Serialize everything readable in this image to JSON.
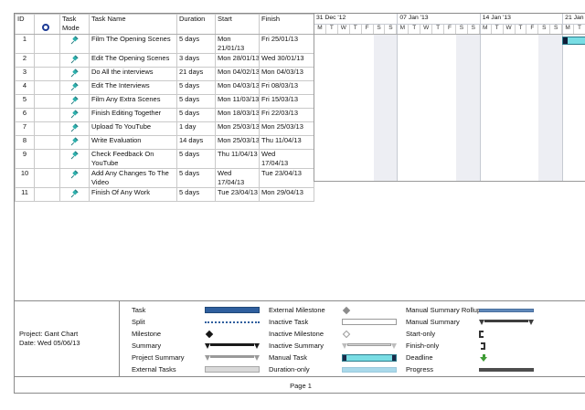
{
  "project_info": {
    "line1": "Project: Gant Chart",
    "line2": "Date: Wed 05/06/13"
  },
  "footer": {
    "page_label": "Page 1"
  },
  "table": {
    "columns": [
      {
        "key": "id",
        "label": "ID"
      },
      {
        "key": "info",
        "label": "",
        "icon": "info-indicator-icon"
      },
      {
        "key": "mode",
        "label": "Task\nMode"
      },
      {
        "key": "name",
        "label": "Task Name"
      },
      {
        "key": "duration",
        "label": "Duration"
      },
      {
        "key": "start",
        "label": "Start"
      },
      {
        "key": "finish",
        "label": "Finish"
      }
    ],
    "rows": [
      {
        "id": "1",
        "mode": "manual-pushpin",
        "name": "Film The Opening Scenes",
        "duration": "5 days",
        "start": "Mon\n21/01/13",
        "finish": "Fri 25/01/13"
      },
      {
        "id": "2",
        "mode": "manual-pushpin",
        "name": "Edit The Opening Scenes",
        "duration": "3 days",
        "start": "Mon 28/01/13",
        "finish": "Wed 30/01/13"
      },
      {
        "id": "3",
        "mode": "manual-pushpin",
        "name": "Do All the interviews",
        "duration": "21 days",
        "start": "Mon 04/02/13",
        "finish": "Mon 04/03/13"
      },
      {
        "id": "4",
        "mode": "manual-pushpin",
        "name": "Edit The Interviews",
        "duration": "5 days",
        "start": "Mon 04/03/13",
        "finish": "Fri 08/03/13"
      },
      {
        "id": "5",
        "mode": "manual-pushpin",
        "name": "Film Any Extra Scenes",
        "duration": "5 days",
        "start": "Mon 11/03/13",
        "finish": "Fri 15/03/13"
      },
      {
        "id": "6",
        "mode": "manual-pushpin",
        "name": "Finish Editing Together",
        "duration": "5 days",
        "start": "Mon 18/03/13",
        "finish": "Fri 22/03/13"
      },
      {
        "id": "7",
        "mode": "manual-pushpin",
        "name": "Upload To YouTube",
        "duration": "1 day",
        "start": "Mon 25/03/13",
        "finish": "Mon 25/03/13"
      },
      {
        "id": "8",
        "mode": "manual-pushpin",
        "name": "Write Evaluation",
        "duration": "14 days",
        "start": "Mon 25/03/13",
        "finish": "Thu 11/04/13"
      },
      {
        "id": "9",
        "mode": "manual-pushpin",
        "name": "Check Feedback On\nYouTube",
        "duration": "5 days",
        "start": "Thu 11/04/13",
        "finish": "Wed\n17/04/13"
      },
      {
        "id": "10",
        "mode": "manual-pushpin",
        "name": "Add Any Changes To The\nVideo",
        "duration": "5 days",
        "start": "Wed\n17/04/13",
        "finish": "Tue 23/04/13"
      },
      {
        "id": "11",
        "mode": "manual-pushpin",
        "name": "Finish Of Any Work",
        "duration": "5 days",
        "start": "Tue 23/04/13",
        "finish": "Mon 29/04/13"
      }
    ]
  },
  "timeline": {
    "weeks": [
      {
        "label": "31 Dec '12",
        "days": [
          "M",
          "T",
          "W",
          "T",
          "F",
          "S",
          "S"
        ]
      },
      {
        "label": "07 Jan '13",
        "days": [
          "M",
          "T",
          "W",
          "T",
          "F",
          "S",
          "S"
        ]
      },
      {
        "label": "14 Jan '13",
        "days": [
          "M",
          "T",
          "W",
          "T",
          "F",
          "S",
          "S"
        ]
      },
      {
        "label": "21 Jan",
        "days": [
          "M",
          "T"
        ]
      }
    ],
    "bar": {
      "task_id": "1",
      "start_day_index": 21,
      "visible_days": 2,
      "style": "manual-task"
    }
  },
  "legend": {
    "columns": [
      [
        {
          "label": "Task",
          "symbol": "task"
        },
        {
          "label": "Split",
          "symbol": "split"
        },
        {
          "label": "Milestone",
          "symbol": "milestone"
        },
        {
          "label": "Summary",
          "symbol": "summary"
        },
        {
          "label": "Project Summary",
          "symbol": "project-summary"
        },
        {
          "label": "External Tasks",
          "symbol": "external-tasks"
        }
      ],
      [
        {
          "label": "External Milestone",
          "symbol": "external-milestone"
        },
        {
          "label": "Inactive Task",
          "symbol": "inactive-task"
        },
        {
          "label": "Inactive Milestone",
          "symbol": "inactive-milestone"
        },
        {
          "label": "Inactive Summary",
          "symbol": "inactive-summary"
        },
        {
          "label": "Manual Task",
          "symbol": "manual-task"
        },
        {
          "label": "Duration-only",
          "symbol": "duration-only"
        }
      ],
      [
        {
          "label": "Manual Summary Rollup",
          "symbol": "manual-summary-rollup"
        },
        {
          "label": "Manual Summary",
          "symbol": "manual-summary"
        },
        {
          "label": "Start-only",
          "symbol": "start-only"
        },
        {
          "label": "Finish-only",
          "symbol": "finish-only"
        },
        {
          "label": "Deadline",
          "symbol": "deadline"
        },
        {
          "label": "Progress",
          "symbol": "progress"
        }
      ]
    ]
  },
  "colors": {
    "manual_task_fill": "#79dde4",
    "manual_task_cap": "#101d38",
    "task_blue": "#2f5f9e",
    "weekend_shade": "#edeef3",
    "pushpin_teal": "#2fb0ad",
    "indicator_blue": "#1e3c96",
    "deadline_green": "#3f9c35"
  }
}
